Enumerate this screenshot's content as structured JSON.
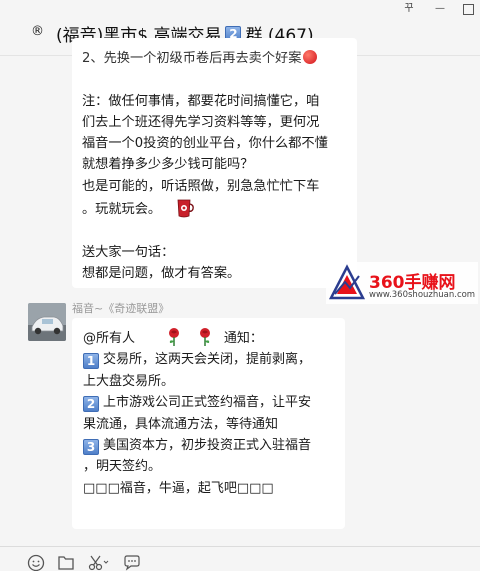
{
  "window": {
    "pin_label": "꾸"
  },
  "header": {
    "reg_mark": "®",
    "title_prefix": "(福音)黑市$ 高端交易",
    "title_badge": "2",
    "title_suffix": "群 (467)"
  },
  "message1": {
    "cut_line": "2、先换一个初级币卷后再去卖个好案",
    "para1_lines": [
      "注：做任何事情，都要花时间搞懂它，咱",
      "们去上个班还得先学习资料等等，更何况",
      "福音一个0投资的创业平台，你什么都不懂",
      "就想着挣多少多少钱可能吗？",
      "也是可能的，听话照做，别急急忙忙下车",
      "。玩就玩会。"
    ],
    "para2_lines": [
      "送大家一句话：",
      "想都是问题，做才有答案。"
    ]
  },
  "message2": {
    "sender": "福音~《奇迹联盟》",
    "line_at": "@所有人",
    "line_notice": "通知：",
    "items": [
      {
        "badge": "1",
        "lines": [
          "交易所，这两天会关闭，提前剥离，",
          "上大盘交易所。"
        ]
      },
      {
        "badge": "2",
        "lines": [
          "上市游戏公司正式签约福音，让平安",
          "果流通，具体流通方法，等待通知"
        ]
      },
      {
        "badge": "3",
        "lines": [
          "美国资本方，初步投资正式入驻福音",
          "，明天签约。"
        ]
      }
    ],
    "closing": "□□□福音，牛逼，起飞吧□□□"
  },
  "watermark": {
    "title": "360手赚网",
    "url": "www.360shouzhuan.com"
  },
  "icons": {
    "emoji": "smile-icon",
    "folder": "folder-icon",
    "cut": "scissors-icon",
    "chat": "chat-bubble-icon"
  }
}
